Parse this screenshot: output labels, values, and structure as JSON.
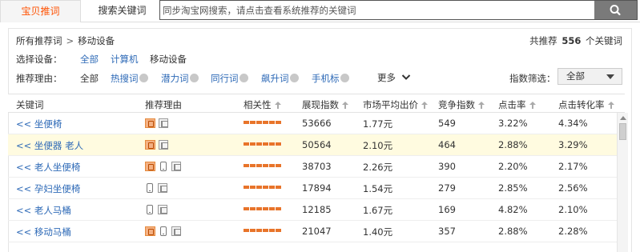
{
  "tabs": {
    "active": "宝贝推词",
    "inactive": "搜索关键词"
  },
  "search": {
    "placeholder": "同步淘宝网搜索，请点击查看系统推荐的关键词",
    "button_icon": "search-icon"
  },
  "breadcrumb": {
    "root": "所有推荐词",
    "sep": ">",
    "current": "移动设备"
  },
  "total": {
    "prefix": "共推荐",
    "count": "556",
    "suffix": "个关键词"
  },
  "device_filter": {
    "label": "选择设备：",
    "options": [
      "全部",
      "计算机",
      "移动设备"
    ]
  },
  "reason_filter": {
    "label": "推荐理由：",
    "options": [
      "全部",
      "热搜词",
      "潜力词",
      "同行词",
      "飙升词",
      "手机标"
    ],
    "more": "更多"
  },
  "index_filter": {
    "label": "指数筛选：",
    "value": "全部"
  },
  "table": {
    "headers": [
      "关键词",
      "推荐理由",
      "相关性",
      "展现指数",
      "市场平均出价",
      "竞争指数",
      "点击率",
      "点击转化率"
    ],
    "rows": [
      {
        "keyword": "<< 坐便椅",
        "reasons": [
          "hot",
          "left"
        ],
        "impressions": "53666",
        "avg_bid": "1.77元",
        "competition": "549",
        "ctr": "3.22%",
        "cvr": "4.34%"
      },
      {
        "keyword": "<< 坐便器 老人",
        "reasons": [
          "hot",
          "left"
        ],
        "impressions": "50564",
        "avg_bid": "2.10元",
        "competition": "464",
        "ctr": "2.88%",
        "cvr": "3.29%"
      },
      {
        "keyword": "<< 老人坐便椅",
        "reasons": [
          "hot",
          "mobile",
          "left"
        ],
        "impressions": "38703",
        "avg_bid": "2.26元",
        "competition": "390",
        "ctr": "2.20%",
        "cvr": "2.17%"
      },
      {
        "keyword": "<< 孕妇坐便椅",
        "reasons": [
          "mobile",
          "left"
        ],
        "impressions": "17894",
        "avg_bid": "1.54元",
        "competition": "279",
        "ctr": "2.85%",
        "cvr": "2.56%"
      },
      {
        "keyword": "<< 老人马桶",
        "reasons": [
          "mobile",
          "left"
        ],
        "impressions": "12185",
        "avg_bid": "1.67元",
        "competition": "169",
        "ctr": "4.82%",
        "cvr": "2.10%"
      },
      {
        "keyword": "<< 移动马桶",
        "reasons": [
          "hot",
          "mobile",
          "left"
        ],
        "impressions": "21047",
        "avg_bid": "1.40元",
        "competition": "357",
        "ctr": "2.88%",
        "cvr": "2.28%"
      }
    ]
  },
  "colors": {
    "accent": "#ff5000",
    "link": "#2e6ab7",
    "relevance_bar": "#e8742a",
    "highlight_row": "#fffbe0"
  }
}
